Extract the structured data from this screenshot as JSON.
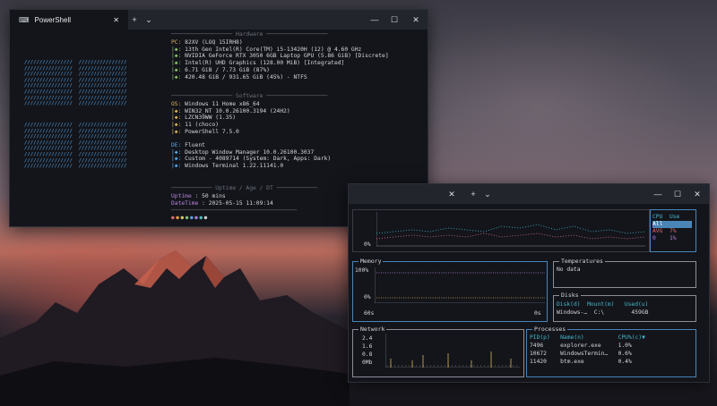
{
  "ps": {
    "tab_title": "PowerShell",
    "close": "✕",
    "new_tab": "+",
    "dropdown": "⌄",
    "min": "—",
    "max": "☐",
    "x": "✕",
    "logo_rows": [
      "////////////////  ////////////////",
      "////////////////  ////////////////",
      "////////////////  ////////////////",
      "////////////////  ////////////////",
      "////////////////  ////////////////",
      "////////////////  ////////////////",
      "////////////////  ////////////////",
      "////////////////  ////////////////"
    ],
    "sections": {
      "hardware": "Hardware",
      "software": "Software",
      "uptime": "Uptime / Age / DT"
    },
    "hw": [
      {
        "key": "PC:",
        "val": "82XV (LOQ 15IRH8)"
      },
      {
        "key": "|◆:",
        "val": "13th Gen Intel(R) Core(TM) i5-13420H (12) @ 4.60 GHz"
      },
      {
        "key": "|◆:",
        "val": "NVIDIA GeForce RTX 3050 6GB Laptop GPU (5.86 GiB) [Discrete]"
      },
      {
        "key": "|◆:",
        "val": "Intel(R) UHD Graphics (128.00 MiB) [Integrated]"
      },
      {
        "key": "|◆:",
        "val": "6.71 GiB / 7.73 GiB (87%)"
      },
      {
        "key": "|◆:",
        "val": "420.48 GiB / 931.65 GiB (45%) - NTFS"
      }
    ],
    "sw": [
      {
        "key": "OS:",
        "val": "Windows 11 Home x86_64"
      },
      {
        "key": "|◆:",
        "val": "WIN32_NT 10.0.26100.3194 (24H2)"
      },
      {
        "key": "|◆:",
        "val": "LZCN39WW (1.35)"
      },
      {
        "key": "|◆:",
        "val": "11 (choco)"
      },
      {
        "key": "|◆:",
        "val": "PowerShell 7.5.0"
      }
    ],
    "de": [
      {
        "key": "DE:",
        "val": "Fluent"
      },
      {
        "key": "|◆:",
        "val": "Desktop Window Manager 10.0.26100.3037"
      },
      {
        "key": "|◆:",
        "val": "Custom - 4089714 (System: Dark, Apps: Dark)"
      },
      {
        "key": "|◆:",
        "val": "Windows Terminal 1.22.11141.0"
      }
    ],
    "uptime_label": "Uptime",
    "uptime_val": " : 50 mins",
    "datetime_label": "DateTime",
    "datetime_val": " : 2025-05-15 11:09:14",
    "dots": "● ● ● ● ● ● ● ●"
  },
  "btm": {
    "close": "✕",
    "new_tab": "+",
    "dropdown": "⌄",
    "min": "—",
    "max": "☐",
    "x": "✕",
    "cpu_pct": "0%",
    "cpu_head": "CPU  Use",
    "cpu_all": "All",
    "cpu_avg": "AVG  7%",
    "cpu_0": "0    1%",
    "memory_title": "Memory",
    "mem_100": "100%",
    "mem_0": "0%",
    "mem_60s": "60s",
    "mem_0s": "0s",
    "temps_title": "Temperatures",
    "temps_nodata": "No data",
    "disks_title": "Disks",
    "disks_head": "Disk(d)  Mount(m)   Used(u)",
    "disks_row": "Windows-…  C:\\        459GB",
    "net_title": "Network",
    "net_y": [
      "2.4",
      "1.6",
      "0.8",
      "0Mb"
    ],
    "proc_title": "Processes",
    "proc_head": "PID(p)   Name(n)          CPU%(c)▼",
    "proc_rows": [
      "7496     explorer.exe     1.0%",
      "10672    WindowsTermin…   0.6%",
      "11420    btm.exe          0.4%"
    ]
  }
}
